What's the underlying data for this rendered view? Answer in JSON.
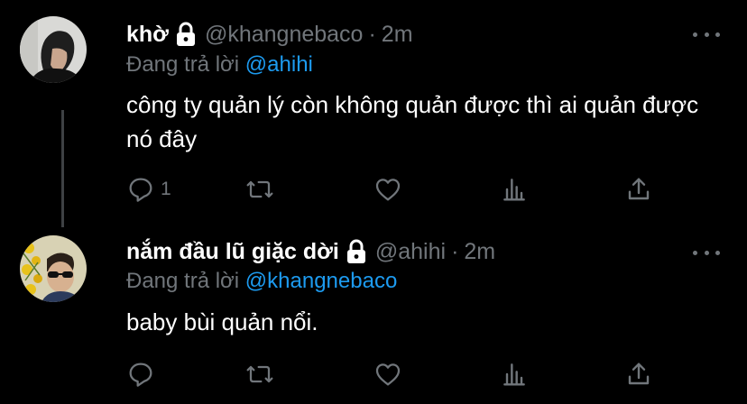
{
  "tweets": [
    {
      "name": "khờ",
      "handle": "@khangnebaco",
      "dot": "·",
      "time": "2m",
      "reply_prefix": "Đang trả lời",
      "reply_mention": "@ahihi",
      "text": "công ty quản lý còn không quản được thì ai quản được nó đây",
      "reply_count": "1",
      "icons": [
        "reply-icon",
        "retweet-icon",
        "like-icon",
        "analytics-icon",
        "share-icon"
      ]
    },
    {
      "name": "nắm đầu lũ giặc dời",
      "handle": "@ahihi",
      "dot": "·",
      "time": "2m",
      "reply_prefix": "Đang trả lời",
      "reply_mention": "@khangnebaco",
      "text": "baby bùi quản nổi.",
      "reply_count": "",
      "icons": [
        "reply-icon",
        "retweet-icon",
        "like-icon",
        "analytics-icon",
        "share-icon"
      ]
    }
  ],
  "colors": {
    "background": "#000000",
    "text": "#ffffff",
    "muted": "#71767b",
    "mention": "#1d9bf0",
    "thread_line": "#3e4144"
  }
}
